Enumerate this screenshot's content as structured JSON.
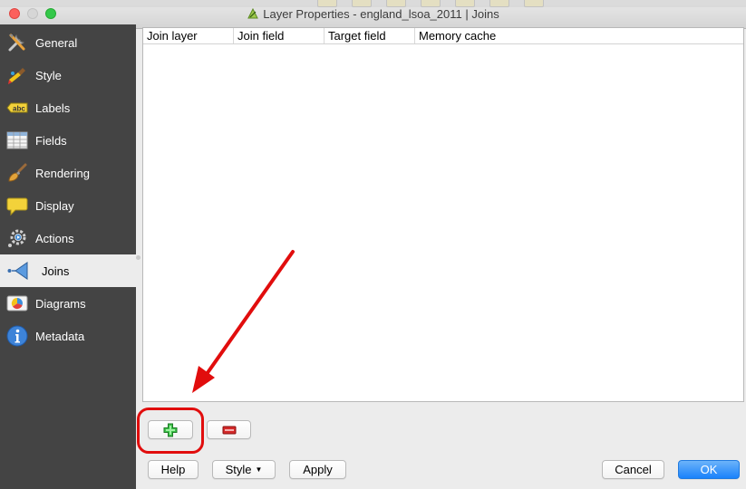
{
  "window": {
    "title": "Layer Properties - england_lsoa_2011 | Joins"
  },
  "sidebar": {
    "items": [
      {
        "label": "General",
        "icon": "general-icon",
        "active": false
      },
      {
        "label": "Style",
        "icon": "style-icon",
        "active": false
      },
      {
        "label": "Labels",
        "icon": "labels-icon",
        "active": false
      },
      {
        "label": "Fields",
        "icon": "fields-icon",
        "active": false
      },
      {
        "label": "Rendering",
        "icon": "rendering-icon",
        "active": false
      },
      {
        "label": "Display",
        "icon": "display-icon",
        "active": false
      },
      {
        "label": "Actions",
        "icon": "actions-icon",
        "active": false
      },
      {
        "label": "Joins",
        "icon": "joins-icon",
        "active": true
      },
      {
        "label": "Diagrams",
        "icon": "diagrams-icon",
        "active": false
      },
      {
        "label": "Metadata",
        "icon": "metadata-icon",
        "active": false
      }
    ],
    "labels_icon_text": "abc"
  },
  "joins_table": {
    "columns": [
      "Join layer",
      "Join field",
      "Target field",
      "Memory cache"
    ],
    "rows": []
  },
  "join_buttons": {
    "add_icon": "add-join-icon",
    "remove_icon": "remove-join-icon"
  },
  "footer": {
    "help_label": "Help",
    "style_label": "Style",
    "apply_label": "Apply",
    "cancel_label": "Cancel",
    "ok_label": "OK"
  },
  "colors": {
    "sidebar_bg": "#444444",
    "active_item_bg": "#ececec",
    "annotation_red": "#e10d0d",
    "primary_button": "#1a82fb",
    "add_green": "#2eb82e",
    "remove_red": "#cc2222"
  }
}
